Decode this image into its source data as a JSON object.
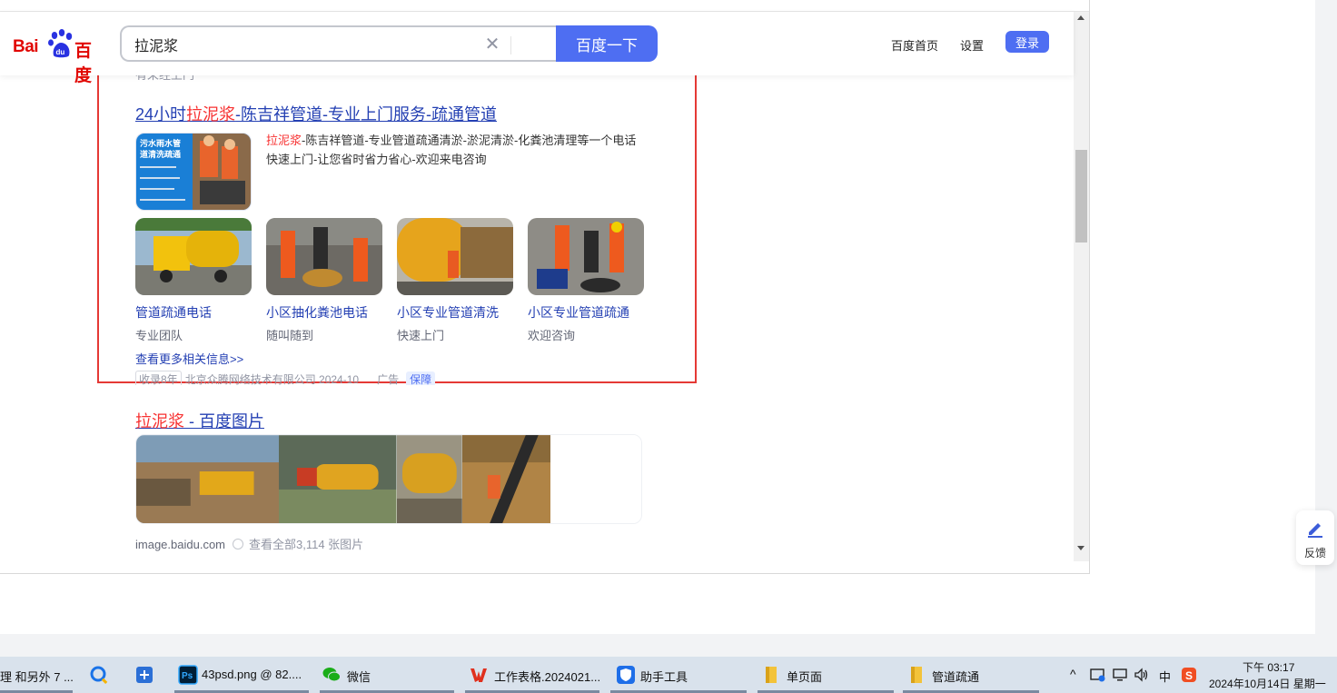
{
  "header": {
    "logo_left": "Bai",
    "logo_mid": "du",
    "logo_right": "百度",
    "search_value": "拉泥浆",
    "search_button": "百度一下",
    "nav_home": "百度首页",
    "nav_settings": "设置",
    "login": "登录"
  },
  "clipped_text": "有采经上门",
  "result_1": {
    "title_pre": "24小时",
    "title_em": "拉泥浆",
    "title_post": "-陈吉祥管道-专业上门服务-疏通管道",
    "thumb_lines": [
      "污水雨水管",
      "道清洗疏通"
    ],
    "desc_em": "拉泥浆",
    "desc": "-陈吉祥管道-专业管道疏通清淤-淤泥清淤-化粪池清理等一个电话快速上门-让您省时省力省心-欢迎来电咨询",
    "sub_items": [
      {
        "title": "管道疏通电话",
        "desc": "专业团队"
      },
      {
        "title": "小区抽化粪池电话",
        "desc": "随叫随到"
      },
      {
        "title": "小区专业管道清洗",
        "desc": "快速上门"
      },
      {
        "title": "小区专业管道疏通",
        "desc": "欢迎咨询"
      }
    ],
    "more": "查看更多相关信息>>",
    "meta_tag": "收录8年",
    "meta_company": "北京众腾网络技术有限公司 2024-10",
    "meta_ad": "广告",
    "meta_badge": "保障"
  },
  "result_2": {
    "title_em": "拉泥浆",
    "title_post": " - 百度图片",
    "source": "image.baidu.com",
    "all": "查看全部3,114 张图片"
  },
  "feedback": "反馈",
  "taskbar": {
    "items": [
      {
        "label": "理 和另外 7 ...",
        "icon": "browser-icon"
      },
      {
        "label": "",
        "icon": "search-app-icon"
      },
      {
        "label": "",
        "icon": "plus-app-icon"
      },
      {
        "label": "43psd.png @ 82....",
        "icon": "photoshop-icon"
      },
      {
        "label": "微信",
        "icon": "wechat-icon"
      },
      {
        "label": "工作表格.2024021...",
        "icon": "wps-icon"
      },
      {
        "label": "助手工具",
        "icon": "shield-app-icon"
      },
      {
        "label": "单页面",
        "icon": "folder-icon"
      },
      {
        "label": "管道疏通",
        "icon": "folder-icon"
      }
    ],
    "tray_chevron": "^",
    "tray_ime": "中",
    "time": "下午 03:17",
    "date": "2024年10月14日 星期一"
  },
  "colors": {
    "accent": "#4e6ef2",
    "link": "#2440b3",
    "highlight": "#f73131",
    "annotation_border": "#e53935"
  }
}
